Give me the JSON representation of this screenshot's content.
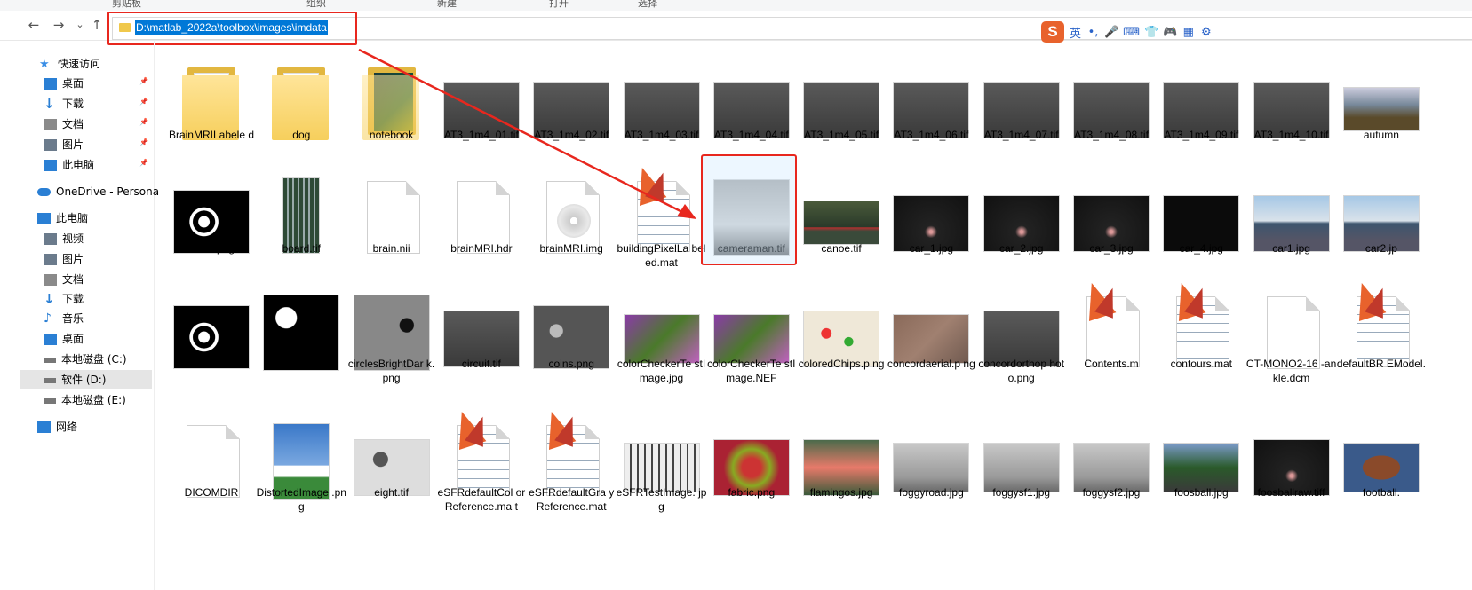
{
  "ribbon": {
    "items": [
      "剪贴板",
      "组织",
      "新建",
      "打开",
      "选择"
    ]
  },
  "nav": {
    "back": "←",
    "forward": "→",
    "recent": "⌄",
    "up": "↑"
  },
  "address": {
    "path": "D:\\matlab_2022a\\toolbox\\images\\imdata"
  },
  "ime": {
    "logo": "S",
    "lang": "英",
    "punct": "•,",
    "mic": "🎤",
    "keyboard": "⌨",
    "skin": "👕",
    "game": "🎮",
    "apps": "▦",
    "settings": "⚙"
  },
  "sidebar": {
    "items": [
      {
        "label": "快速访问",
        "icon": "star-icon",
        "pinned": false
      },
      {
        "label": "桌面",
        "icon": "desktop-icon",
        "pinned": true
      },
      {
        "label": "下载",
        "icon": "download-icon",
        "pinned": true
      },
      {
        "label": "文档",
        "icon": "document-icon",
        "pinned": true
      },
      {
        "label": "图片",
        "icon": "picture-icon",
        "pinned": true
      },
      {
        "label": "此电脑",
        "icon": "computer-icon",
        "pinned": true
      },
      {
        "label": "OneDrive - Persona",
        "icon": "cloud-icon",
        "pinned": false
      },
      {
        "label": "此电脑",
        "icon": "computer-icon",
        "pinned": false
      },
      {
        "label": "视频",
        "icon": "video-icon",
        "pinned": false
      },
      {
        "label": "图片",
        "icon": "picture-icon",
        "pinned": false
      },
      {
        "label": "文档",
        "icon": "document-icon",
        "pinned": false
      },
      {
        "label": "下载",
        "icon": "download-icon",
        "pinned": false
      },
      {
        "label": "音乐",
        "icon": "music-icon",
        "pinned": false
      },
      {
        "label": "桌面",
        "icon": "desktop-icon",
        "pinned": false
      },
      {
        "label": "本地磁盘 (C:)",
        "icon": "drive-icon",
        "pinned": false
      },
      {
        "label": "软件 (D:)",
        "icon": "drive-icon",
        "pinned": false,
        "selected": true
      },
      {
        "label": "本地磁盘 (E:)",
        "icon": "drive-icon",
        "pinned": false
      },
      {
        "label": "网络",
        "icon": "network-icon",
        "pinned": false
      }
    ]
  },
  "files": {
    "rows": [
      [
        {
          "name": "BrainMRILabele d",
          "kind": "folder"
        },
        {
          "name": "dog",
          "kind": "folder"
        },
        {
          "name": "notebook",
          "kind": "folder-dark"
        },
        {
          "name": "AT3_1m4_01.tif",
          "kind": "gray-image"
        },
        {
          "name": "AT3_1m4_02.tif",
          "kind": "gray-image"
        },
        {
          "name": "AT3_1m4_03.tif",
          "kind": "gray-image"
        },
        {
          "name": "AT3_1m4_04.tif",
          "kind": "gray-image"
        },
        {
          "name": "AT3_1m4_05.tif",
          "kind": "gray-image"
        },
        {
          "name": "AT3_1m4_06.tif",
          "kind": "gray-image"
        },
        {
          "name": "AT3_1m4_07.tif",
          "kind": "gray-image"
        },
        {
          "name": "AT3_1m4_08.tif",
          "kind": "gray-image"
        },
        {
          "name": "AT3_1m4_09.tif",
          "kind": "gray-image"
        },
        {
          "name": "AT3_1m4_10.tif",
          "kind": "gray-image"
        },
        {
          "name": "autumn",
          "kind": "photo"
        }
      ],
      [
        {
          "name": "blobs.png",
          "kind": "bw-image"
        },
        {
          "name": "board.tif",
          "kind": "board-image"
        },
        {
          "name": "brain.nii",
          "kind": "blank-doc"
        },
        {
          "name": "brainMRI.hdr",
          "kind": "blank-doc"
        },
        {
          "name": "brainMRI.img",
          "kind": "disc-doc"
        },
        {
          "name": "buildingPixelLa beled.mat",
          "kind": "matlab-mat"
        },
        {
          "name": "cameraman.tif",
          "kind": "cameraman",
          "selected": true
        },
        {
          "name": "canoe.tif",
          "kind": "photo-canoe"
        },
        {
          "name": "car_1.jpg",
          "kind": "photo-dark"
        },
        {
          "name": "car_2.jpg",
          "kind": "photo-dark"
        },
        {
          "name": "car_3.jpg",
          "kind": "photo-dark"
        },
        {
          "name": "car_4.jpg",
          "kind": "photo-black"
        },
        {
          "name": "car1.jpg",
          "kind": "photo-car"
        },
        {
          "name": "car2.jp",
          "kind": "photo-car"
        }
      ],
      [
        {
          "name": "circbw.tif",
          "kind": "bw-image"
        },
        {
          "name": "circles.png",
          "kind": "circles-image"
        },
        {
          "name": "circlesBrightDar k.png",
          "kind": "circles-gray"
        },
        {
          "name": "circuit.tif",
          "kind": "gray-image"
        },
        {
          "name": "coins.png",
          "kind": "coins-image"
        },
        {
          "name": "colorCheckerTe stImage.jpg",
          "kind": "photo-flowers"
        },
        {
          "name": "colorCheckerTe stImage.NEF",
          "kind": "photo-flowers"
        },
        {
          "name": "coloredChips.p ng",
          "kind": "photo-chips"
        },
        {
          "name": "concordaerial.p ng",
          "kind": "photo-aerial"
        },
        {
          "name": "concordorthop hoto.png",
          "kind": "gray-image"
        },
        {
          "name": "Contents.m",
          "kind": "matlab-m"
        },
        {
          "name": "contours.mat",
          "kind": "matlab-mat"
        },
        {
          "name": "CT-MONO2-16 -ankle.dcm",
          "kind": "blank-doc"
        },
        {
          "name": "defaultBR EModel.",
          "kind": "matlab-mat"
        }
      ],
      [
        {
          "name": "DICOMDIR",
          "kind": "blank-doc"
        },
        {
          "name": "DistortedImage .png",
          "kind": "photo-lighthouse"
        },
        {
          "name": "eight.tif",
          "kind": "coins-light"
        },
        {
          "name": "eSFRdefaultCol orReference.ma t",
          "kind": "matlab-mat"
        },
        {
          "name": "eSFRdefaultGra yReference.mat",
          "kind": "matlab-mat"
        },
        {
          "name": "eSFRTestImage. jpg",
          "kind": "chart-image"
        },
        {
          "name": "fabric.png",
          "kind": "photo-fabric"
        },
        {
          "name": "flamingos.jpg",
          "kind": "photo-flamingo"
        },
        {
          "name": "foggyroad.jpg",
          "kind": "photo-fog"
        },
        {
          "name": "foggysf1.jpg",
          "kind": "photo-fog"
        },
        {
          "name": "foggysf2.jpg",
          "kind": "photo-fog"
        },
        {
          "name": "foosball.jpg",
          "kind": "photo-foosball"
        },
        {
          "name": "foosballraw.tiff",
          "kind": "photo-dark"
        },
        {
          "name": "football.",
          "kind": "photo-football"
        }
      ]
    ]
  },
  "colors": {
    "accent": "#0078d7",
    "annotation": "#e8271e",
    "selection": "#cce8ff"
  }
}
